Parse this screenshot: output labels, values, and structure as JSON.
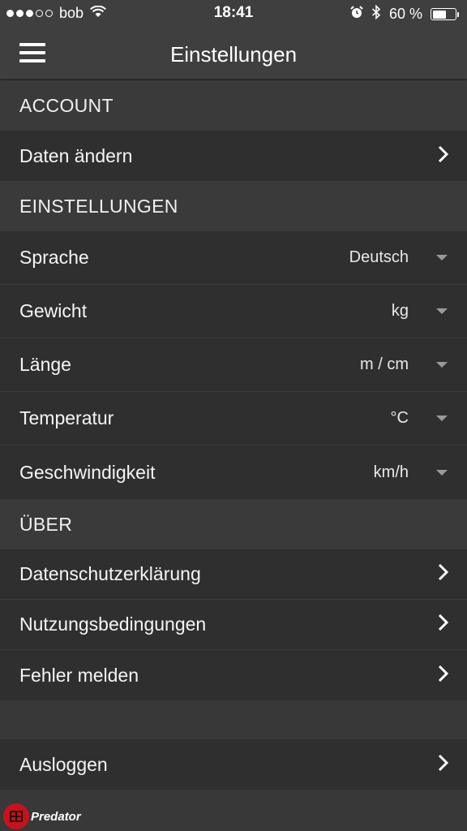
{
  "status_bar": {
    "carrier": "bob",
    "time": "18:41",
    "battery_text": "60 %",
    "battery_level": 0.6,
    "signal_bars_filled": 3,
    "signal_bars_total": 5
  },
  "navbar": {
    "title": "Einstellungen",
    "menu_icon": "hamburger-menu-icon"
  },
  "sections": {
    "account": {
      "header": "ACCOUNT",
      "items": [
        {
          "label": "Daten ändern"
        }
      ]
    },
    "settings": {
      "header": "EINSTELLUNGEN",
      "items": [
        {
          "label": "Sprache",
          "value": "Deutsch"
        },
        {
          "label": "Gewicht",
          "value": "kg"
        },
        {
          "label": "Länge",
          "value": "m / cm"
        },
        {
          "label": "Temperatur",
          "value": "°C"
        },
        {
          "label": "Geschwindigkeit",
          "value": "km/h"
        }
      ]
    },
    "about": {
      "header": "ÜBER",
      "items": [
        {
          "label": "Datenschutzerklärung"
        },
        {
          "label": "Nutzungsbedingungen"
        },
        {
          "label": "Fehler melden"
        }
      ]
    }
  },
  "logout": {
    "label": "Ausloggen"
  },
  "logo": {
    "text": "Predator"
  },
  "colors": {
    "background": "#383838",
    "row_background": "#2f2f2f",
    "header_background": "#3a3a3a",
    "navbar_background": "#3f3f3f",
    "logo_red": "#c8121b"
  }
}
